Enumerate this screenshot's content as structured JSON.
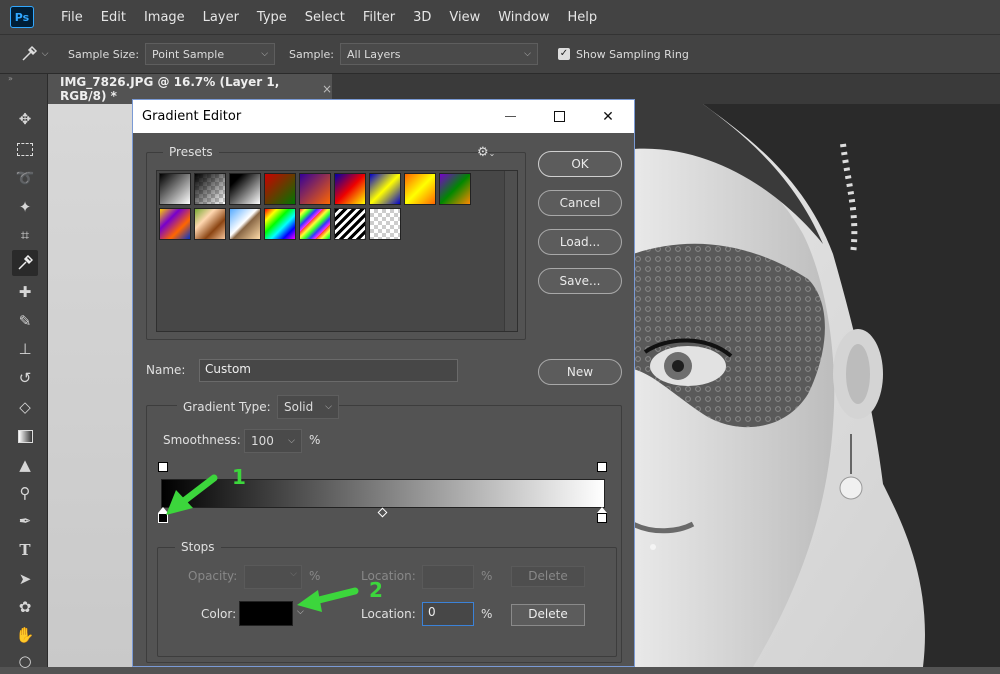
{
  "app": {
    "logo": "Ps"
  },
  "menu": [
    "File",
    "Edit",
    "Image",
    "Layer",
    "Type",
    "Select",
    "Filter",
    "3D",
    "View",
    "Window",
    "Help"
  ],
  "options": {
    "sample_size_label": "Sample Size:",
    "sample_size_value": "Point Sample",
    "sample_label": "Sample:",
    "sample_value": "All Layers",
    "show_ring_label": "Show Sampling Ring",
    "show_ring_checked": true
  },
  "document_tab": {
    "title": "IMG_7826.JPG @ 16.7% (Layer 1, RGB/8) *",
    "close": "×"
  },
  "dialog": {
    "title": "Gradient Editor",
    "presets_label": "Presets",
    "buttons": {
      "ok": "OK",
      "cancel": "Cancel",
      "load": "Load...",
      "save": "Save...",
      "new": "New"
    },
    "name_label": "Name:",
    "name_value": "Custom",
    "gradient_type_label": "Gradient Type:",
    "gradient_type_value": "Solid",
    "smoothness_label": "Smoothness:",
    "smoothness_value": "100",
    "smoothness_unit": "%",
    "stops_label": "Stops",
    "opacity_label": "Opacity:",
    "opacity_unit": "%",
    "location_label": "Location:",
    "location_unit": "%",
    "delete_label": "Delete",
    "color_label": "Color:",
    "color_location_label": "Location:",
    "color_location_value": "0",
    "color_location_unit": "%",
    "color_delete_label": "Delete",
    "stop_color": "#000000"
  },
  "annotations": {
    "arrow1": "1",
    "arrow2": "2"
  },
  "colors": {
    "accent": "#31a8ff",
    "annotation_green": "#3cd63c",
    "dialog_border": "#7a9ad5"
  }
}
